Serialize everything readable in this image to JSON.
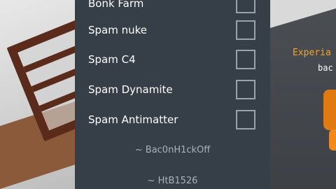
{
  "menu": {
    "items": [
      {
        "label": "Bonk Farm",
        "checked": false
      },
      {
        "label": "Spam nuke",
        "checked": false
      },
      {
        "label": "Spam C4",
        "checked": false
      },
      {
        "label": "Spam Dynamite",
        "checked": false
      },
      {
        "label": "Spam Antimatter",
        "checked": false
      }
    ],
    "credits": [
      "~ Bac0nH1ckOff",
      "~ HtB1526"
    ]
  },
  "game": {
    "nametag_title": "Experia",
    "nametag_sub": "bac"
  },
  "colors": {
    "menu_bg": "#363f48",
    "checkbox_border": "#9aa3ad",
    "credit_text": "#a9b1ba",
    "nametag_title": "#f5a623"
  }
}
